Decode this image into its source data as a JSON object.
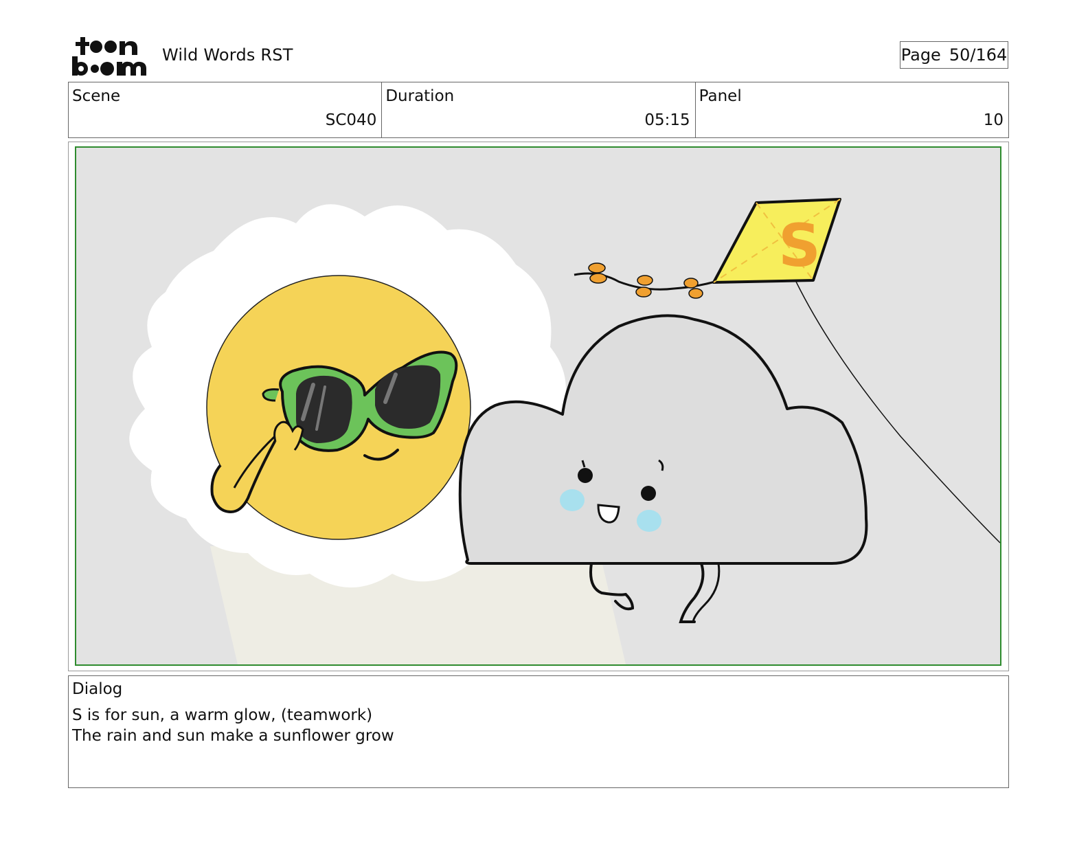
{
  "header": {
    "logo_text": "toon boom",
    "project_title": "Wild Words RST",
    "page_label": "Page",
    "page_value": "50/164"
  },
  "info": {
    "scene_label": "Scene",
    "scene_value": "SC040",
    "duration_label": "Duration",
    "duration_value": "05:15",
    "panel_label": "Panel",
    "panel_value": "10"
  },
  "panel_art": {
    "kite_letter": "S",
    "colors": {
      "background": "#e3e3e3",
      "sun": "#f5d357",
      "glasses": "#6cc35a",
      "kite": "#f7ee5c",
      "kite_letter": "#f0a030",
      "cheeks": "#a8e0ee",
      "frame_border": "#2e8b2e"
    }
  },
  "dialog": {
    "label": "Dialog",
    "lines": [
      "S is for sun, a warm glow, (teamwork)",
      "The rain and sun make a sunflower grow"
    ]
  }
}
